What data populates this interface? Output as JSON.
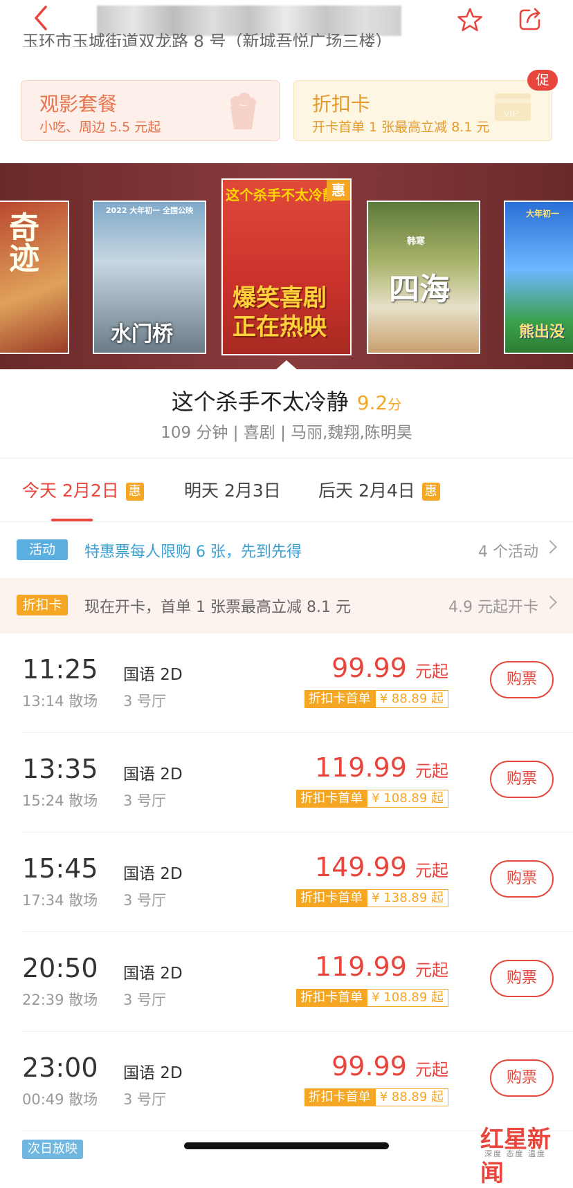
{
  "header": {
    "address": "玉环市玉城街道双龙路 8 号（新城吾悦广场三楼）"
  },
  "promos": [
    {
      "title": "观影套餐",
      "subtitle": "小吃、周边 5.5 元起"
    },
    {
      "title": "折扣卡",
      "subtitle": "开卡首单 1 张最高立减 8.1 元",
      "badge": "促"
    }
  ],
  "posters": [
    {
      "text": "奇迹"
    },
    {
      "text": "水门桥",
      "top_text": "2022 大年初一 全国公映"
    },
    {
      "text": "爆笑喜剧 正在热映",
      "top_text": "这个杀手不太冷静",
      "badge": "惠"
    },
    {
      "text": "四海",
      "top_text": "韩寒"
    },
    {
      "text": "熊出没",
      "top_text": "大年初一"
    }
  ],
  "movie": {
    "title": "这个杀手不太冷静",
    "score": "9.2",
    "score_unit": "分",
    "meta": "109 分钟 | 喜剧 | 马丽,魏翔,陈明昊"
  },
  "tabs": [
    {
      "label": "今天 2月2日",
      "badge": "惠"
    },
    {
      "label": "明天 2月3日"
    },
    {
      "label": "后天 2月4日",
      "badge": "惠"
    }
  ],
  "activity": {
    "badge": "活动",
    "text": "特惠票每人限购 6 张，先到先得",
    "right": "4 个活动"
  },
  "card": {
    "badge": "折扣卡",
    "text": "现在开卡，首单 1 张票最高立减 8.1 元",
    "right": "4.9 元起开卡"
  },
  "showtimes": [
    {
      "time": "11:25",
      "end": "13:14 散场",
      "lang": "国语 2D",
      "hall": "3 号厅",
      "price": "99.99",
      "unit": "元起",
      "disc_label": "折扣卡首单",
      "disc_price": "¥ 88.89 起",
      "buy": "购票"
    },
    {
      "time": "13:35",
      "end": "15:24 散场",
      "lang": "国语 2D",
      "hall": "3 号厅",
      "price": "119.99",
      "unit": "元起",
      "disc_label": "折扣卡首单",
      "disc_price": "¥ 108.89 起",
      "buy": "购票"
    },
    {
      "time": "15:45",
      "end": "17:34 散场",
      "lang": "国语 2D",
      "hall": "3 号厅",
      "price": "149.99",
      "unit": "元起",
      "disc_label": "折扣卡首单",
      "disc_price": "¥ 138.89 起",
      "buy": "购票"
    },
    {
      "time": "20:50",
      "end": "22:39 散场",
      "lang": "国语 2D",
      "hall": "3 号厅",
      "price": "119.99",
      "unit": "元起",
      "disc_label": "折扣卡首单",
      "disc_price": "¥ 108.89 起",
      "buy": "购票"
    },
    {
      "time": "23:00",
      "end": "00:49 散场",
      "lang": "国语 2D",
      "hall": "3 号厅",
      "price": "99.99",
      "unit": "元起",
      "disc_label": "折扣卡首单",
      "disc_price": "¥ 88.89 起",
      "buy": "购票"
    }
  ],
  "next_day_label": "次日放映",
  "watermark": {
    "main": "红星新闻",
    "sub": "深度 态度 温度"
  },
  "colors": {
    "accent": "#e8453c",
    "orange": "#f5a623",
    "blue": "#3b9fd3"
  }
}
